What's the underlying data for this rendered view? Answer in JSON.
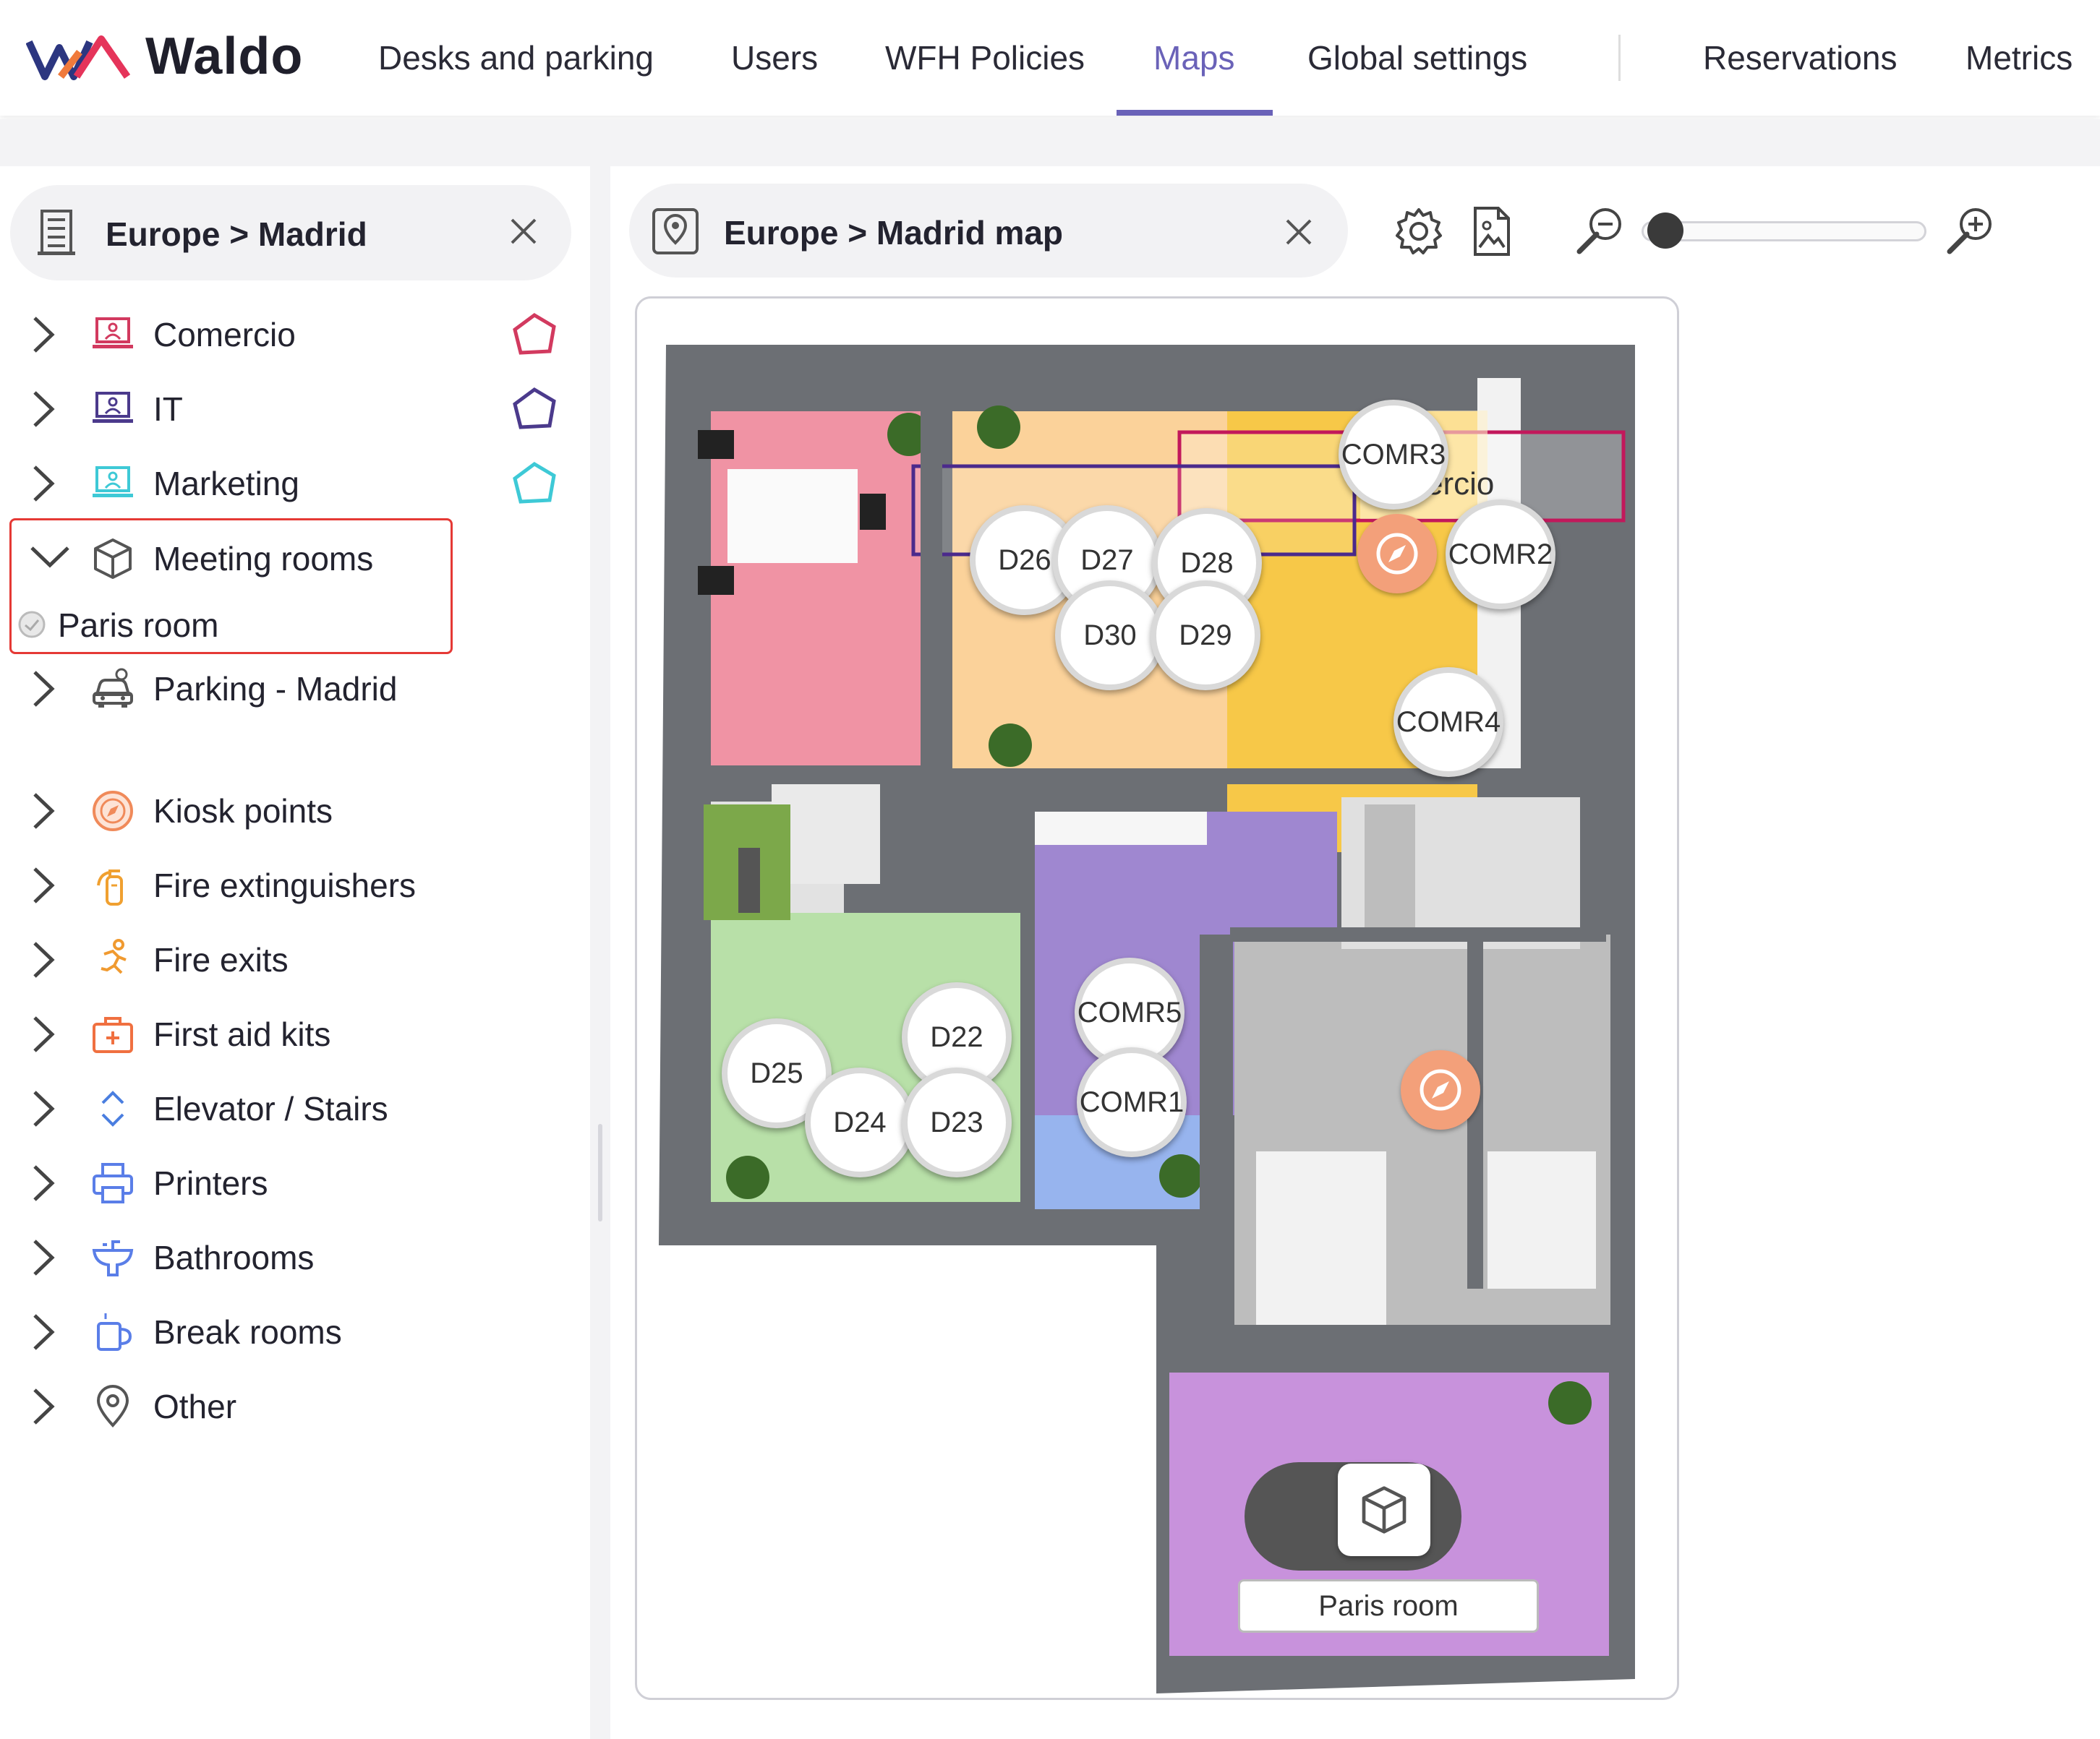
{
  "app": {
    "brand": "Waldo"
  },
  "nav": {
    "items": [
      "Desks and parking",
      "Users",
      "WFH Policies",
      "Maps",
      "Global settings",
      "Reservations",
      "Metrics"
    ],
    "active": "Maps",
    "accent": "#6a62b8"
  },
  "left": {
    "breadcrumb": "Europe > Madrid",
    "close_icon": "close-icon",
    "tree": [
      {
        "label": "Comercio",
        "icon": "department-icon",
        "color": "#d23a5f",
        "expanded": false
      },
      {
        "label": "IT",
        "icon": "department-icon",
        "color": "#4b3a8c",
        "expanded": false
      },
      {
        "label": "Marketing",
        "icon": "department-icon",
        "color": "#3ec9d6",
        "expanded": false
      },
      {
        "label": "Meeting rooms",
        "icon": "cube-icon",
        "expanded": true
      },
      {
        "label": "Paris room",
        "icon": "status-dot-icon",
        "child": true
      },
      {
        "label": "Parking - Madrid",
        "icon": "car-icon",
        "expanded": false
      },
      {
        "label": "Kiosk points",
        "icon": "compass-icon",
        "expanded": false
      },
      {
        "label": "Fire extinguishers",
        "icon": "fire-extinguisher-icon",
        "expanded": false
      },
      {
        "label": "Fire exits",
        "icon": "running-person-icon",
        "expanded": false
      },
      {
        "label": "First aid kits",
        "icon": "first-aid-icon",
        "expanded": false
      },
      {
        "label": "Elevator / Stairs",
        "icon": "up-down-icon",
        "expanded": false
      },
      {
        "label": "Printers",
        "icon": "printer-icon",
        "expanded": false
      },
      {
        "label": "Bathrooms",
        "icon": "sink-icon",
        "expanded": false
      },
      {
        "label": "Break rooms",
        "icon": "cup-icon",
        "expanded": false
      },
      {
        "label": "Other",
        "icon": "map-pin-icon",
        "expanded": false
      }
    ]
  },
  "map": {
    "breadcrumb": "Europe > Madrid map",
    "tools": [
      "settings-icon",
      "image-file-icon",
      "zoom-out-icon",
      "zoom-in-icon"
    ],
    "zoom_level": 0.05,
    "desks": [
      "D26",
      "D27",
      "D28",
      "D30",
      "D29",
      "D22",
      "D25",
      "D24",
      "D23"
    ],
    "meeting_markers": [
      "COMR3",
      "COMR2",
      "COMR4",
      "COMR5",
      "COMR1"
    ],
    "zone_label": "ercio",
    "room_label": "Paris room"
  }
}
